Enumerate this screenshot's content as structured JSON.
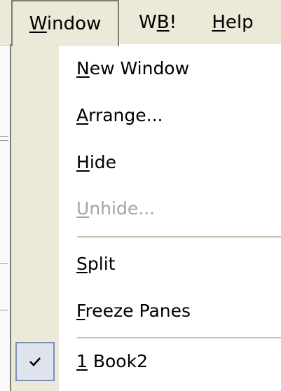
{
  "menubar": {
    "items": [
      {
        "label": "Window",
        "hotkey": "W",
        "rest": "indow"
      },
      {
        "label": "WB!",
        "prefix": "W",
        "hotkey": "B",
        "rest": "!"
      },
      {
        "label": "Help",
        "hotkey": "H",
        "rest": "elp"
      }
    ]
  },
  "menu": {
    "items": [
      {
        "label": "New Window",
        "hotkey": "N",
        "rest": "ew Window",
        "enabled": true
      },
      {
        "label": "Arrange...",
        "hotkey": "A",
        "rest": "rrange...",
        "enabled": true
      },
      {
        "label": "Hide",
        "hotkey": "H",
        "rest": "ide",
        "enabled": true
      },
      {
        "label": "Unhide...",
        "hotkey": "U",
        "rest": "nhide...",
        "enabled": false
      },
      {
        "label": "Split",
        "hotkey": "S",
        "rest": "plit",
        "enabled": true
      },
      {
        "label": "Freeze Panes",
        "hotkey": "F",
        "rest": "reeze Panes",
        "enabled": true
      },
      {
        "label": "1 Book2",
        "hotkey": "1",
        "rest": " Book2",
        "enabled": true,
        "checked": true
      }
    ]
  },
  "colors": {
    "menubar_bg": "#ece9d8",
    "gutter_bg": "#ece9d8",
    "disabled_text": "#a5a49c",
    "check_box_border": "#7f8fb4",
    "check_box_bg": "#dfe3ee"
  },
  "icons": {
    "checkmark": "checkmark-icon"
  }
}
